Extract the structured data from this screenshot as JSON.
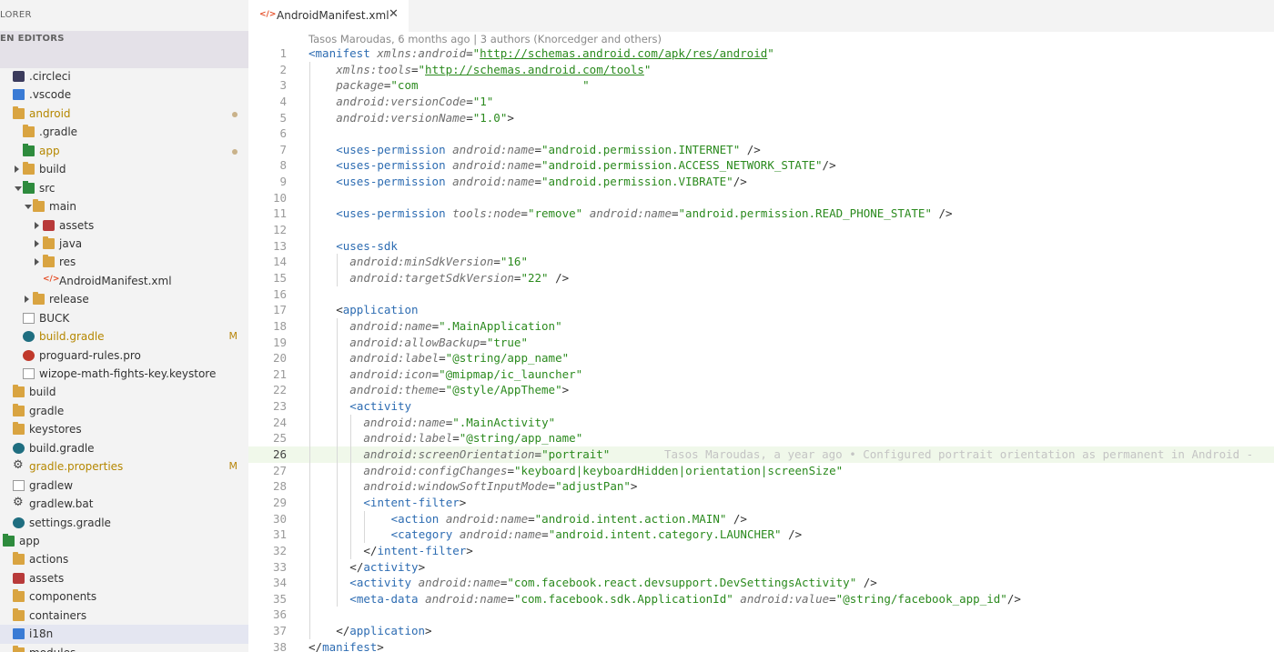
{
  "sidebar": {
    "title": "LORER",
    "open_editors": "EN EDITORS",
    "items": [
      {
        "label": ".circleci",
        "indent": 0,
        "icon": "circleci-icon",
        "twisty": ""
      },
      {
        "label": ".vscode",
        "indent": 0,
        "icon": "vscode-folder-icon",
        "twisty": ""
      },
      {
        "label": "android",
        "indent": 0,
        "icon": "folder-icon",
        "twisty": "",
        "dot": true,
        "modified": true
      },
      {
        "label": ".gradle",
        "indent": 1,
        "icon": "folder-icon",
        "twisty": ""
      },
      {
        "label": "app",
        "indent": 1,
        "icon": "app-folder-icon",
        "twisty": "",
        "dot": true,
        "modified": true
      },
      {
        "label": "build",
        "indent": 1,
        "icon": "folder-icon",
        "twisty": "right"
      },
      {
        "label": "src",
        "indent": 1,
        "icon": "src-folder-icon",
        "twisty": "down"
      },
      {
        "label": "main",
        "indent": 2,
        "icon": "folder-icon",
        "twisty": "down"
      },
      {
        "label": "assets",
        "indent": 3,
        "icon": "assets-folder-icon",
        "twisty": "right"
      },
      {
        "label": "java",
        "indent": 3,
        "icon": "folder-icon",
        "twisty": "right"
      },
      {
        "label": "res",
        "indent": 3,
        "icon": "folder-icon",
        "twisty": "right"
      },
      {
        "label": "AndroidManifest.xml",
        "indent": 3,
        "icon": "xml-file-icon",
        "twisty": ""
      },
      {
        "label": "release",
        "indent": 2,
        "icon": "folder-icon",
        "twisty": "right"
      },
      {
        "label": "BUCK",
        "indent": 1,
        "icon": "file-icon",
        "twisty": ""
      },
      {
        "label": "build.gradle",
        "indent": 1,
        "icon": "gradle-icon",
        "twisty": "",
        "badge": "M",
        "modified": true
      },
      {
        "label": "proguard-rules.pro",
        "indent": 1,
        "icon": "proguard-icon",
        "twisty": ""
      },
      {
        "label": "wizope-math-fights-key.keystore",
        "indent": 1,
        "icon": "file-icon",
        "twisty": ""
      },
      {
        "label": "build",
        "indent": 0,
        "icon": "folder-icon",
        "twisty": ""
      },
      {
        "label": "gradle",
        "indent": 0,
        "icon": "folder-icon",
        "twisty": ""
      },
      {
        "label": "keystores",
        "indent": 0,
        "icon": "folder-icon",
        "twisty": ""
      },
      {
        "label": "build.gradle",
        "indent": 0,
        "icon": "gradle-icon",
        "twisty": ""
      },
      {
        "label": "gradle.properties",
        "indent": 0,
        "icon": "gear-icon",
        "twisty": "",
        "badge": "M",
        "modified": true
      },
      {
        "label": "gradlew",
        "indent": 0,
        "icon": "file-icon",
        "twisty": ""
      },
      {
        "label": "gradlew.bat",
        "indent": 0,
        "icon": "gear-icon",
        "twisty": ""
      },
      {
        "label": "settings.gradle",
        "indent": 0,
        "icon": "gradle-icon",
        "twisty": ""
      },
      {
        "label": "app",
        "indent": -1,
        "icon": "app-folder-icon",
        "twisty": ""
      },
      {
        "label": "actions",
        "indent": 0,
        "icon": "folder-icon",
        "twisty": ""
      },
      {
        "label": "assets",
        "indent": 0,
        "icon": "assets-folder-icon",
        "twisty": ""
      },
      {
        "label": "components",
        "indent": 0,
        "icon": "folder-icon",
        "twisty": ""
      },
      {
        "label": "containers",
        "indent": 0,
        "icon": "folder-icon",
        "twisty": ""
      },
      {
        "label": "i18n",
        "indent": 0,
        "icon": "i18n-folder-icon",
        "twisty": "",
        "selected": true
      },
      {
        "label": "modules",
        "indent": 0,
        "icon": "folder-icon",
        "twisty": ""
      }
    ]
  },
  "tab": {
    "icon_text": "</>",
    "label": "AndroidManifest.xml",
    "close": "✕"
  },
  "blame_header": "Tasos Maroudas, 6 months ago | 3 authors (Knorcedger and others)",
  "inline_blame": "Tasos Maroudas, a year ago • Configured portrait orientation as permanent in Android -",
  "current_line": 26,
  "code_lines": [
    {
      "n": "1",
      "guides": 0,
      "tokens": [
        [
          "tag",
          "<manifest"
        ],
        [
          "p",
          " "
        ],
        [
          "attr",
          "xmlns:android"
        ],
        [
          "p",
          "="
        ],
        [
          "str",
          "\""
        ],
        [
          "url",
          "http://schemas.android.com/apk/res/android"
        ],
        [
          "str",
          "\""
        ]
      ]
    },
    {
      "n": "2",
      "guides": 1,
      "tokens": [
        [
          "attr",
          "xmlns:tools"
        ],
        [
          "p",
          "="
        ],
        [
          "str",
          "\""
        ],
        [
          "url",
          "http://schemas.android.com/tools"
        ],
        [
          "str",
          "\""
        ]
      ]
    },
    {
      "n": "3",
      "guides": 1,
      "tokens": [
        [
          "attr",
          "package"
        ],
        [
          "p",
          "="
        ],
        [
          "str",
          "\"com                        \""
        ]
      ]
    },
    {
      "n": "4",
      "guides": 1,
      "tokens": [
        [
          "attr",
          "android:versionCode"
        ],
        [
          "p",
          "="
        ],
        [
          "str",
          "\"1\""
        ]
      ]
    },
    {
      "n": "5",
      "guides": 1,
      "tokens": [
        [
          "attr",
          "android:versionName"
        ],
        [
          "p",
          "="
        ],
        [
          "str",
          "\"1.0\""
        ],
        [
          "p",
          ">"
        ]
      ]
    },
    {
      "n": "6",
      "guides": 1,
      "tokens": []
    },
    {
      "n": "7",
      "guides": 1,
      "tokens": [
        [
          "tag",
          "<uses-permission"
        ],
        [
          "p",
          " "
        ],
        [
          "attr",
          "android:name"
        ],
        [
          "p",
          "="
        ],
        [
          "str",
          "\"android.permission.INTERNET\""
        ],
        [
          "p",
          " />"
        ]
      ]
    },
    {
      "n": "8",
      "guides": 1,
      "tokens": [
        [
          "tag",
          "<uses-permission"
        ],
        [
          "p",
          " "
        ],
        [
          "attr",
          "android:name"
        ],
        [
          "p",
          "="
        ],
        [
          "str",
          "\"android.permission.ACCESS_NETWORK_STATE\""
        ],
        [
          "p",
          "/>"
        ]
      ]
    },
    {
      "n": "9",
      "guides": 1,
      "tokens": [
        [
          "tag",
          "<uses-permission"
        ],
        [
          "p",
          " "
        ],
        [
          "attr",
          "android:name"
        ],
        [
          "p",
          "="
        ],
        [
          "str",
          "\"android.permission.VIBRATE\""
        ],
        [
          "p",
          "/>"
        ]
      ]
    },
    {
      "n": "10",
      "guides": 1,
      "tokens": []
    },
    {
      "n": "11",
      "guides": 1,
      "tokens": [
        [
          "tag",
          "<uses-permission"
        ],
        [
          "p",
          " "
        ],
        [
          "attr",
          "tools:node"
        ],
        [
          "p",
          "="
        ],
        [
          "str",
          "\"remove\""
        ],
        [
          "p",
          " "
        ],
        [
          "attr",
          "android:name"
        ],
        [
          "p",
          "="
        ],
        [
          "str",
          "\"android.permission.READ_PHONE_STATE\""
        ],
        [
          "p",
          " />"
        ]
      ]
    },
    {
      "n": "12",
      "guides": 1,
      "tokens": []
    },
    {
      "n": "13",
      "guides": 1,
      "tokens": [
        [
          "tag",
          "<uses-sdk"
        ]
      ]
    },
    {
      "n": "14",
      "guides": 2,
      "tokens": [
        [
          "attr",
          "android:minSdkVersion"
        ],
        [
          "p",
          "="
        ],
        [
          "str",
          "\"16\""
        ]
      ]
    },
    {
      "n": "15",
      "guides": 2,
      "tokens": [
        [
          "attr",
          "android:targetSdkVersion"
        ],
        [
          "p",
          "="
        ],
        [
          "str",
          "\"22\""
        ],
        [
          "p",
          " />"
        ]
      ]
    },
    {
      "n": "16",
      "guides": 1,
      "tokens": []
    },
    {
      "n": "17",
      "guides": 1,
      "tokens": [
        [
          "p",
          "<"
        ],
        [
          "tag",
          "application"
        ]
      ]
    },
    {
      "n": "18",
      "guides": 2,
      "tokens": [
        [
          "attr",
          "android:name"
        ],
        [
          "p",
          "="
        ],
        [
          "str",
          "\".MainApplication\""
        ]
      ]
    },
    {
      "n": "19",
      "guides": 2,
      "tokens": [
        [
          "attr",
          "android:allowBackup"
        ],
        [
          "p",
          "="
        ],
        [
          "str",
          "\"true\""
        ]
      ]
    },
    {
      "n": "20",
      "guides": 2,
      "tokens": [
        [
          "attr",
          "android:label"
        ],
        [
          "p",
          "="
        ],
        [
          "str",
          "\"@string/app_name\""
        ]
      ]
    },
    {
      "n": "21",
      "guides": 2,
      "tokens": [
        [
          "attr",
          "android:icon"
        ],
        [
          "p",
          "="
        ],
        [
          "str",
          "\"@mipmap/ic_launcher\""
        ]
      ]
    },
    {
      "n": "22",
      "guides": 2,
      "tokens": [
        [
          "attr",
          "android:theme"
        ],
        [
          "p",
          "="
        ],
        [
          "str",
          "\"@style/AppTheme\""
        ],
        [
          "p",
          ">"
        ]
      ]
    },
    {
      "n": "23",
      "guides": 2,
      "tokens": [
        [
          "tag",
          "<activity"
        ]
      ]
    },
    {
      "n": "24",
      "guides": 3,
      "tokens": [
        [
          "attr",
          "android:name"
        ],
        [
          "p",
          "="
        ],
        [
          "str",
          "\".MainActivity\""
        ]
      ]
    },
    {
      "n": "25",
      "guides": 3,
      "tokens": [
        [
          "attr",
          "android:label"
        ],
        [
          "p",
          "="
        ],
        [
          "str",
          "\"@string/app_name\""
        ]
      ]
    },
    {
      "n": "26",
      "guides": 3,
      "tokens": [
        [
          "attr",
          "android:screenOrientation"
        ],
        [
          "p",
          "="
        ],
        [
          "str",
          "\"portrait\""
        ]
      ]
    },
    {
      "n": "27",
      "guides": 3,
      "tokens": [
        [
          "attr",
          "android:configChanges"
        ],
        [
          "p",
          "="
        ],
        [
          "str",
          "\"keyboard|keyboardHidden|orientation|screenSize\""
        ]
      ]
    },
    {
      "n": "28",
      "guides": 3,
      "tokens": [
        [
          "attr",
          "android:windowSoftInputMode"
        ],
        [
          "p",
          "="
        ],
        [
          "str",
          "\"adjustPan\""
        ],
        [
          "p",
          ">"
        ]
      ]
    },
    {
      "n": "29",
      "guides": 3,
      "tokens": [
        [
          "tag",
          "<intent-filter"
        ],
        [
          "p",
          ">"
        ]
      ]
    },
    {
      "n": "30",
      "guides": 4,
      "tokens": [
        [
          "tag",
          "<action"
        ],
        [
          "p",
          " "
        ],
        [
          "attr",
          "android:name"
        ],
        [
          "p",
          "="
        ],
        [
          "str",
          "\"android.intent.action.MAIN\""
        ],
        [
          "p",
          " />"
        ]
      ]
    },
    {
      "n": "31",
      "guides": 4,
      "tokens": [
        [
          "tag",
          "<category"
        ],
        [
          "p",
          " "
        ],
        [
          "attr",
          "android:name"
        ],
        [
          "p",
          "="
        ],
        [
          "str",
          "\"android.intent.category.LAUNCHER\""
        ],
        [
          "p",
          " />"
        ]
      ]
    },
    {
      "n": "32",
      "guides": 3,
      "tokens": [
        [
          "p",
          "</"
        ],
        [
          "tag",
          "intent-filter"
        ],
        [
          "p",
          ">"
        ]
      ]
    },
    {
      "n": "33",
      "guides": 2,
      "tokens": [
        [
          "p",
          "</"
        ],
        [
          "tag",
          "activity"
        ],
        [
          "p",
          ">"
        ]
      ]
    },
    {
      "n": "34",
      "guides": 2,
      "tokens": [
        [
          "tag",
          "<activity"
        ],
        [
          "p",
          " "
        ],
        [
          "attr",
          "android:name"
        ],
        [
          "p",
          "="
        ],
        [
          "str",
          "\"com.facebook.react.devsupport.DevSettingsActivity\""
        ],
        [
          "p",
          " />"
        ]
      ]
    },
    {
      "n": "35",
      "guides": 2,
      "tokens": [
        [
          "tag",
          "<meta-data"
        ],
        [
          "p",
          " "
        ],
        [
          "attr",
          "android:name"
        ],
        [
          "p",
          "="
        ],
        [
          "str",
          "\"com.facebook.sdk.ApplicationId\""
        ],
        [
          "p",
          " "
        ],
        [
          "attr",
          "android:value"
        ],
        [
          "p",
          "="
        ],
        [
          "str",
          "\"@string/facebook_app_id\""
        ],
        [
          "p",
          "/>"
        ]
      ]
    },
    {
      "n": "36",
      "guides": 1,
      "tokens": []
    },
    {
      "n": "37",
      "guides": 1,
      "tokens": [
        [
          "p",
          "</"
        ],
        [
          "tag",
          "application"
        ],
        [
          "p",
          ">"
        ]
      ]
    },
    {
      "n": "38",
      "guides": 0,
      "tokens": [
        [
          "p",
          "</"
        ],
        [
          "tag",
          "manifest"
        ],
        [
          "p",
          ">"
        ]
      ]
    }
  ]
}
